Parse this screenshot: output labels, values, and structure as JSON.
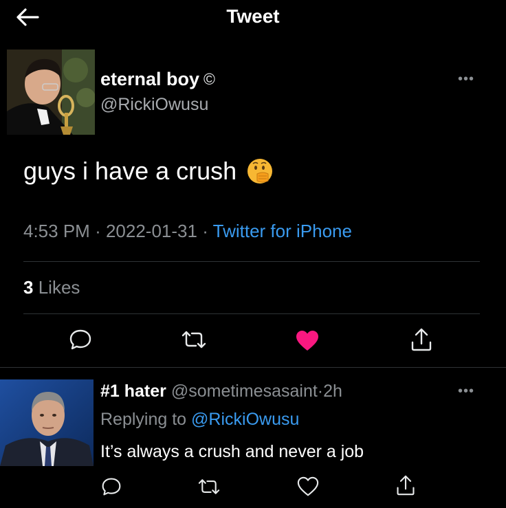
{
  "header": {
    "title": "Tweet",
    "back_icon": "arrow-left-icon"
  },
  "main_tweet": {
    "author_name": "eternal boy",
    "name_symbol": "©",
    "author_handle": "@RickiOwusu",
    "text": "guys i have a crush",
    "emoji": "face-with-hand-over-mouth",
    "time": "4:53 PM",
    "date": "2022-01-31",
    "separator": "·",
    "source": "Twitter for iPhone",
    "likes_count": "3",
    "likes_label": "Likes",
    "liked": true
  },
  "reply": {
    "author_name": "#1 hater",
    "author_handle": "@sometimesasaint",
    "separator": "·",
    "time_ago": "2h",
    "replying_label": "Replying to",
    "replying_to": "@RickiOwusu",
    "text": "It’s always a crush and never a job"
  },
  "colors": {
    "background": "#000000",
    "link": "#3a9bf0",
    "like": "#f91880",
    "secondary_text": "#8b8f93",
    "divider": "#2f3336"
  }
}
